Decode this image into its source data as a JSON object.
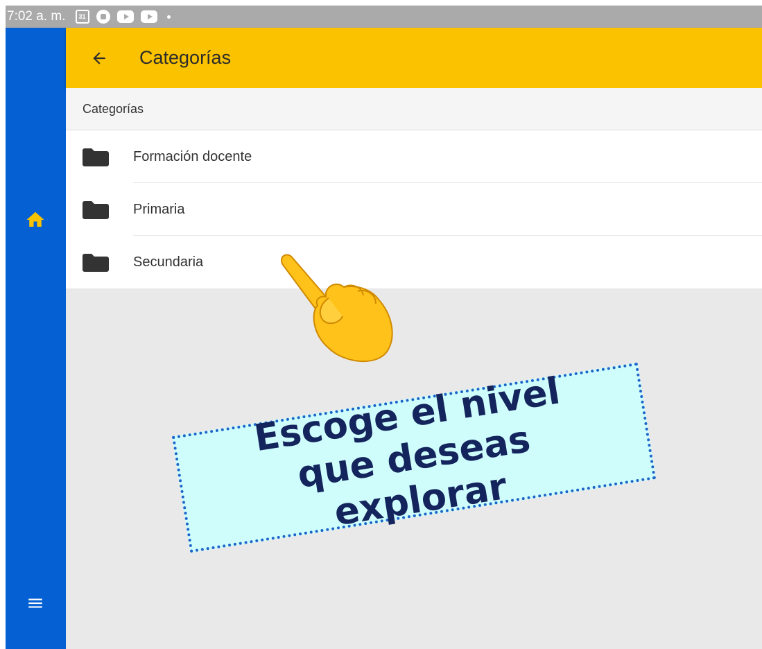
{
  "status_bar": {
    "time": "7:02 a. m.",
    "calendar_day": "31",
    "icons": [
      "calendar-icon",
      "notification-icon",
      "youtube-icon",
      "youtube-icon",
      "dot-icon"
    ]
  },
  "side_rail": {
    "items": [
      {
        "name": "home",
        "icon": "home-icon",
        "color": "#fbc200"
      },
      {
        "name": "menu",
        "icon": "menu-icon",
        "color": "#ffffff"
      }
    ]
  },
  "app_bar": {
    "back_icon": "arrow-back-icon",
    "title": "Categorías"
  },
  "breadcrumb": "Categorías",
  "categories": [
    {
      "label": "Formación docente",
      "icon": "folder-icon"
    },
    {
      "label": "Primaria",
      "icon": "folder-icon"
    },
    {
      "label": "Secundaria",
      "icon": "folder-icon"
    }
  ],
  "overlay": {
    "callout_text": "Escoge el nivel que deseas explorar",
    "pointer_icon": "pointing-hand-icon"
  },
  "colors": {
    "app_bar": "#fbc200",
    "side_rail": "#0561d3",
    "callout_bg": "#cffdfc",
    "callout_border": "#1d64c8",
    "callout_text": "#14245c"
  }
}
